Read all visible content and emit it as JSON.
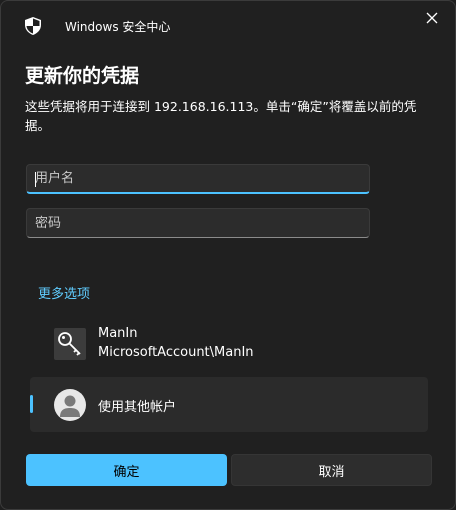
{
  "window": {
    "app_title": "Windows 安全中心",
    "close_label": "×"
  },
  "dialog": {
    "heading": "更新你的凭据",
    "description": "这些凭据将用于连接到 192.168.16.113。单击“确定”将覆盖以前的凭据。"
  },
  "form": {
    "username_placeholder": "用户名",
    "username_value": "",
    "password_placeholder": "密码",
    "password_value": ""
  },
  "more_options_label": "更多选项",
  "accounts": [
    {
      "name": "ManIn",
      "detail": "MicrosoftAccount\\ManIn",
      "icon": "key-icon"
    },
    {
      "label": "使用其他帐户",
      "icon": "user-avatar-icon",
      "selected": true
    }
  ],
  "buttons": {
    "ok": "确定",
    "cancel": "取消"
  },
  "colors": {
    "accent": "#4cc2ff",
    "link": "#60cdff",
    "background": "#202020"
  }
}
